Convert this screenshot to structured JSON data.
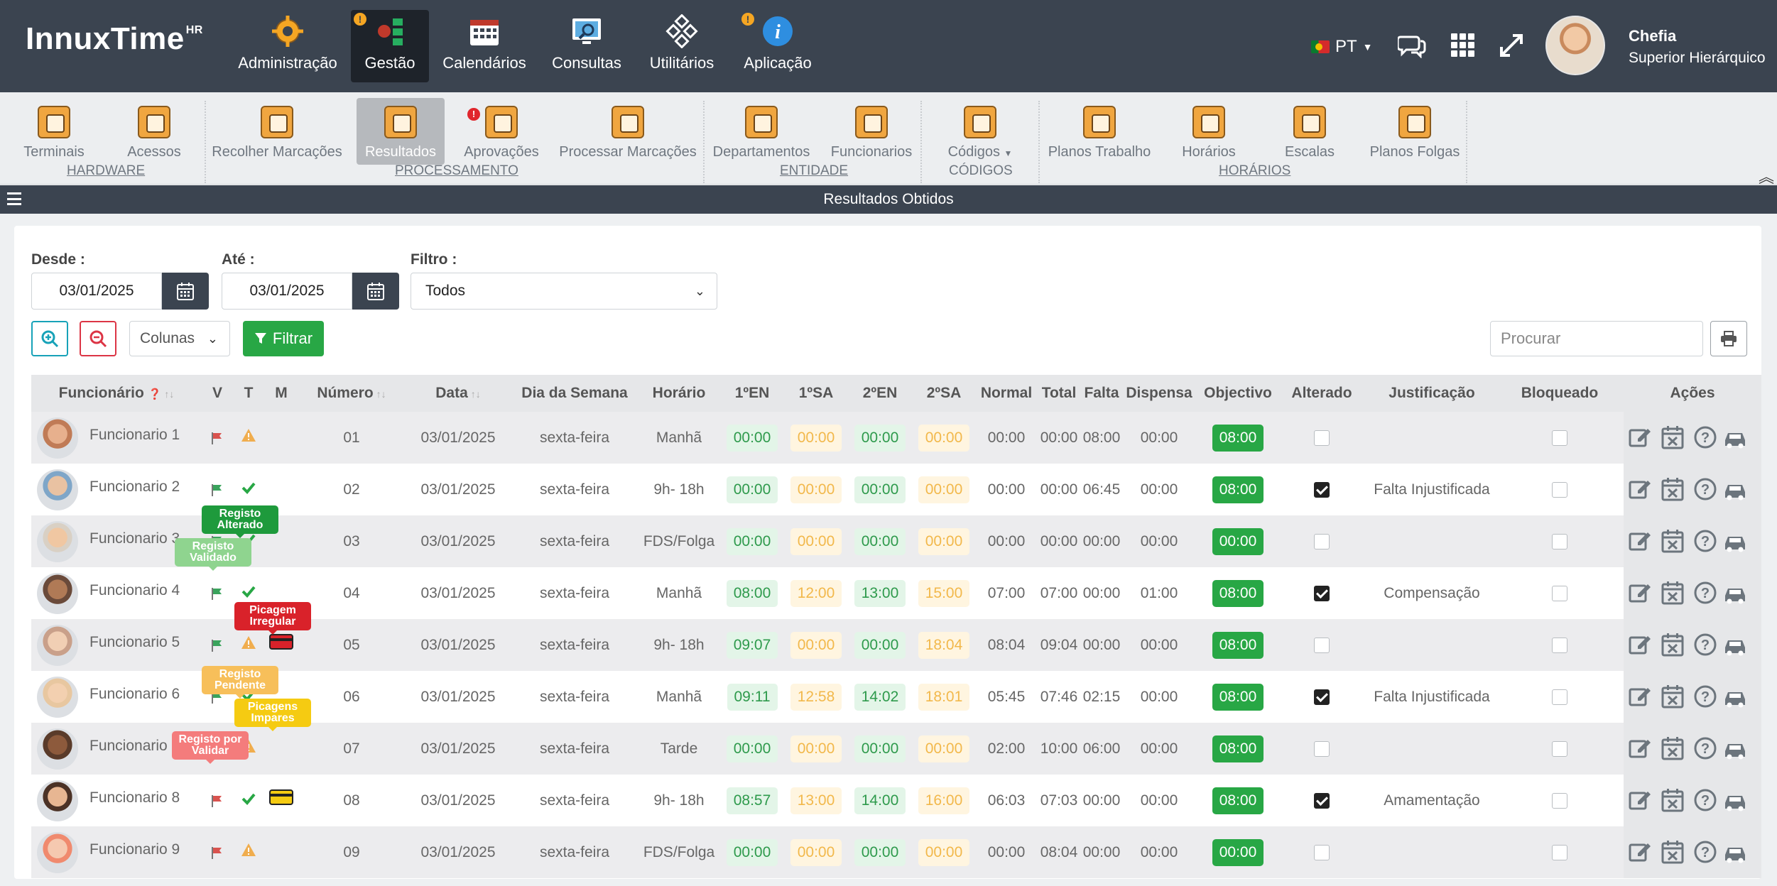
{
  "app": {
    "logo": "InnuxTime",
    "logo_sup": "HR"
  },
  "topnav": {
    "items": [
      {
        "label": "Administração",
        "icon": "gear-icon",
        "badge": false,
        "active": false
      },
      {
        "label": "Gestão",
        "icon": "management-icon",
        "badge": true,
        "active": true
      },
      {
        "label": "Calendários",
        "icon": "calendar-icon",
        "badge": false,
        "active": false
      },
      {
        "label": "Consultas",
        "icon": "monitor-search-icon",
        "badge": false,
        "active": false
      },
      {
        "label": "Utilitários",
        "icon": "utilities-icon",
        "badge": false,
        "active": false
      },
      {
        "label": "Aplicação",
        "icon": "info-icon",
        "badge": true,
        "active": false
      }
    ],
    "language": "PT",
    "user": {
      "name": "Chefia",
      "role": "Superior Hierárquico"
    }
  },
  "ribbon": {
    "items": [
      {
        "label": "Terminais",
        "active": false,
        "badge": false
      },
      {
        "label": "Acessos",
        "active": false,
        "badge": false
      },
      {
        "label": "Recolher Marcações",
        "active": false,
        "badge": false
      },
      {
        "label": "Resultados",
        "active": true,
        "badge": false
      },
      {
        "label": "Aprovações",
        "active": false,
        "badge": true
      },
      {
        "label": "Processar Marcações",
        "active": false,
        "badge": false
      },
      {
        "label": "Departamentos",
        "active": false,
        "badge": false
      },
      {
        "label": "Funcionarios",
        "active": false,
        "badge": false
      },
      {
        "label": "Códigos",
        "active": false,
        "badge": false
      },
      {
        "label": "Planos Trabalho",
        "active": false,
        "badge": false
      },
      {
        "label": "Horários",
        "active": false,
        "badge": false
      },
      {
        "label": "Escalas",
        "active": false,
        "badge": false
      },
      {
        "label": "Planos Folgas",
        "active": false,
        "badge": false
      }
    ],
    "groups": [
      "HARDWARE",
      "PROCESSAMENTO",
      "ENTIDADE",
      "CÓDIGOS",
      "HORÁRIOS"
    ]
  },
  "titlebar": {
    "title": "Resultados Obtidos"
  },
  "filters": {
    "desde_label": "Desde :",
    "desde_value": "03/01/2025",
    "ate_label": "Até :",
    "ate_value": "03/01/2025",
    "filtro_label": "Filtro :",
    "filtro_value": "Todos",
    "colunas_label": "Colunas",
    "filtrar_label": "Filtrar",
    "search_placeholder": "Procurar"
  },
  "table": {
    "headers": {
      "funcionario": "Funcionário",
      "v": "V",
      "t": "T",
      "m": "M",
      "numero": "Número",
      "data": "Data",
      "dia": "Dia da Semana",
      "horario": "Horário",
      "en1": "1ºEN",
      "sa1": "1ºSA",
      "en2": "2ºEN",
      "sa2": "2ºSA",
      "normal": "Normal",
      "total": "Total",
      "falta": "Falta",
      "dispensa": "Dispensa",
      "objectivo": "Objectivo",
      "alterado": "Alterado",
      "justificacao": "Justificação",
      "bloqueado": "Bloqueado",
      "acoes": "Ações"
    },
    "rows": [
      {
        "name": "Funcionario 1",
        "v_flag": "red",
        "t": "warning",
        "m": "",
        "numero": "01",
        "data": "03/01/2025",
        "dia": "sexta-feira",
        "horario": "Manhã",
        "en1": "00:00",
        "sa1": "00:00",
        "en2": "00:00",
        "sa2": "00:00",
        "normal": "00:00",
        "total": "00:00",
        "falta": "08:00",
        "dispensa": "00:00",
        "objectivo": "08:00",
        "alterado": false,
        "justificacao": "",
        "bloqueado": false
      },
      {
        "name": "Funcionario 2",
        "v_flag": "green",
        "t": "check",
        "m": "",
        "numero": "02",
        "data": "03/01/2025",
        "dia": "sexta-feira",
        "horario": "9h- 18h",
        "en1": "00:00",
        "sa1": "00:00",
        "en2": "00:00",
        "sa2": "00:00",
        "normal": "00:00",
        "total": "00:00",
        "falta": "06:45",
        "dispensa": "00:00",
        "objectivo": "08:00",
        "alterado": true,
        "justificacao": "Falta Injustificada",
        "bloqueado": false
      },
      {
        "name": "Funcionario 3",
        "v_flag": "green",
        "t": "check",
        "m": "",
        "numero": "03",
        "data": "03/01/2025",
        "dia": "sexta-feira",
        "horario": "FDS/Folga",
        "en1": "00:00",
        "sa1": "00:00",
        "en2": "00:00",
        "sa2": "00:00",
        "normal": "00:00",
        "total": "00:00",
        "falta": "00:00",
        "dispensa": "00:00",
        "objectivo": "00:00",
        "alterado": false,
        "justificacao": "",
        "bloqueado": false
      },
      {
        "name": "Funcionario 4",
        "v_flag": "green",
        "t": "check",
        "m": "",
        "numero": "04",
        "data": "03/01/2025",
        "dia": "sexta-feira",
        "horario": "Manhã",
        "en1": "08:00",
        "sa1": "12:00",
        "en2": "13:00",
        "sa2": "15:00",
        "normal": "07:00",
        "total": "07:00",
        "falta": "00:00",
        "dispensa": "01:00",
        "objectivo": "08:00",
        "alterado": true,
        "justificacao": "Compensação",
        "bloqueado": false
      },
      {
        "name": "Funcionario 5",
        "v_flag": "green",
        "t": "warning",
        "m": "red-card",
        "numero": "05",
        "data": "03/01/2025",
        "dia": "sexta-feira",
        "horario": "9h- 18h",
        "en1": "09:07",
        "sa1": "00:00",
        "en2": "00:00",
        "sa2": "18:04",
        "normal": "08:04",
        "total": "09:04",
        "falta": "00:00",
        "dispensa": "00:00",
        "objectivo": "08:00",
        "alterado": false,
        "justificacao": "",
        "bloqueado": false
      },
      {
        "name": "Funcionario 6",
        "v_flag": "green",
        "t": "check",
        "m": "",
        "numero": "06",
        "data": "03/01/2025",
        "dia": "sexta-feira",
        "horario": "Manhã",
        "en1": "09:11",
        "sa1": "12:58",
        "en2": "14:02",
        "sa2": "18:01",
        "normal": "05:45",
        "total": "07:46",
        "falta": "02:15",
        "dispensa": "00:00",
        "objectivo": "08:00",
        "alterado": true,
        "justificacao": "Falta Injustificada",
        "bloqueado": false
      },
      {
        "name": "Funcionario 7",
        "v_flag": "red",
        "t": "warning",
        "m": "",
        "numero": "07",
        "data": "03/01/2025",
        "dia": "sexta-feira",
        "horario": "Tarde",
        "en1": "00:00",
        "sa1": "00:00",
        "en2": "00:00",
        "sa2": "00:00",
        "normal": "02:00",
        "total": "10:00",
        "falta": "06:00",
        "dispensa": "00:00",
        "objectivo": "08:00",
        "alterado": false,
        "justificacao": "",
        "bloqueado": false
      },
      {
        "name": "Funcionario 8",
        "v_flag": "red",
        "t": "check",
        "m": "yellow-card",
        "numero": "08",
        "data": "03/01/2025",
        "dia": "sexta-feira",
        "horario": "9h- 18h",
        "en1": "08:57",
        "sa1": "13:00",
        "en2": "14:00",
        "sa2": "16:00",
        "normal": "06:03",
        "total": "07:03",
        "falta": "00:00",
        "dispensa": "00:00",
        "objectivo": "08:00",
        "alterado": true,
        "justificacao": "Amamentação",
        "bloqueado": false
      },
      {
        "name": "Funcionario 9",
        "v_flag": "red",
        "t": "warning",
        "m": "",
        "numero": "09",
        "data": "03/01/2025",
        "dia": "sexta-feira",
        "horario": "FDS/Folga",
        "en1": "00:00",
        "sa1": "00:00",
        "en2": "00:00",
        "sa2": "00:00",
        "normal": "00:00",
        "total": "08:04",
        "falta": "00:00",
        "dispensa": "00:00",
        "objectivo": "00:00",
        "alterado": false,
        "justificacao": "",
        "bloqueado": false
      }
    ]
  },
  "legend_tips": [
    {
      "text": "Registo Alterado",
      "color": "#1e9a3c"
    },
    {
      "text": "Registo Validado",
      "color": "#8fd48f"
    },
    {
      "text": "Picagem Irregular",
      "color": "#d9222a"
    },
    {
      "text": "Registo Pendente",
      "color": "#f7bf5a"
    },
    {
      "text": "Picagens Impares",
      "color": "#f5cb12"
    },
    {
      "text": "Registo por Validar",
      "color": "#f47c7c"
    }
  ],
  "colors": {
    "nav": "#3b4450",
    "accent_green": "#28a745",
    "active_nav": "#1e232a"
  }
}
